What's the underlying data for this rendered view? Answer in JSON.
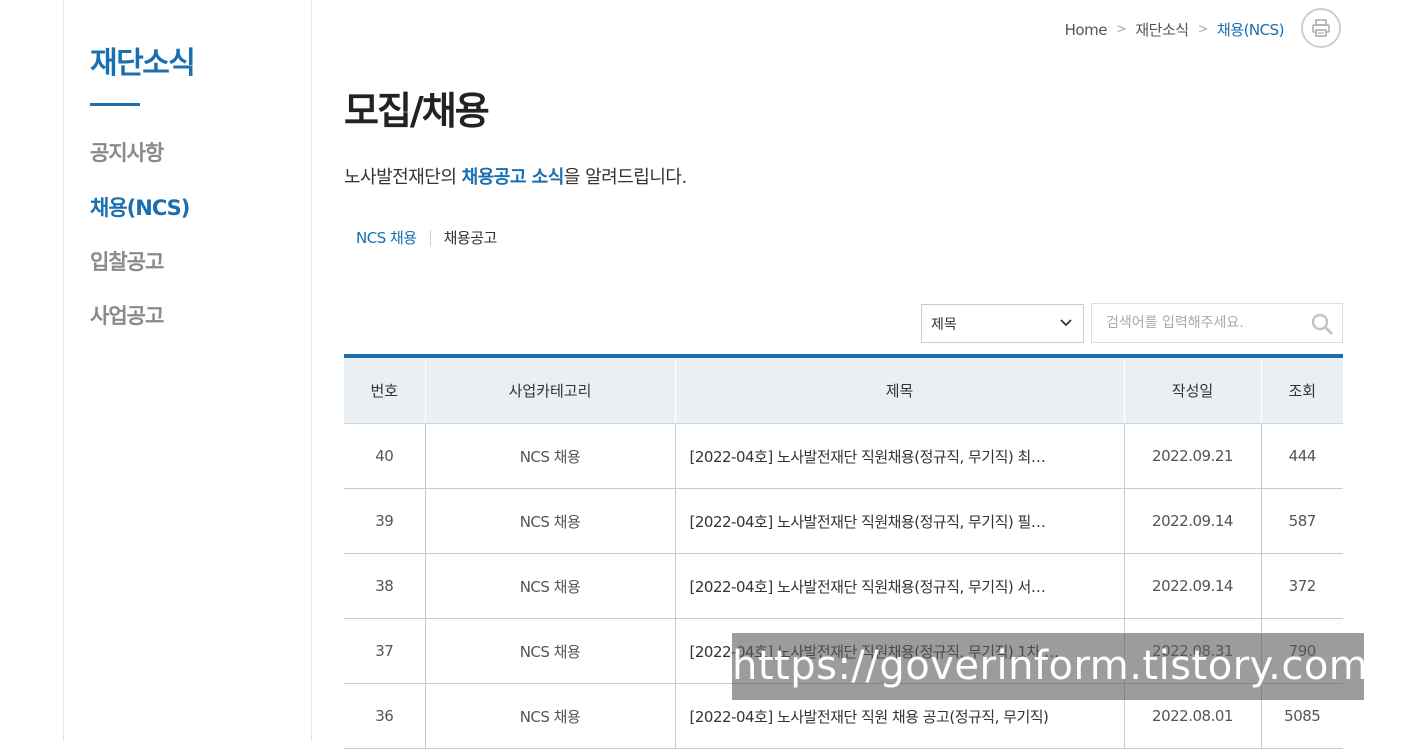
{
  "sidebar": {
    "title": "재단소식",
    "items": [
      {
        "label": "공지사항",
        "active": false
      },
      {
        "label": "채용(NCS)",
        "active": true
      },
      {
        "label": "입찰공고",
        "active": false
      },
      {
        "label": "사업공고",
        "active": false
      }
    ]
  },
  "breadcrumb": {
    "home": "Home",
    "level1": "재단소식",
    "current": "채용(NCS)"
  },
  "print_icon": "printer-icon",
  "page": {
    "title": "모집/채용",
    "intro_before": "노사발전재단의 ",
    "intro_highlight": "채용공고 소식",
    "intro_after": "을 알려드립니다."
  },
  "tabs": [
    {
      "label": "NCS 채용",
      "active": true
    },
    {
      "label": "채용공고",
      "active": false
    }
  ],
  "search": {
    "select_value": "제목",
    "placeholder": "검색어를 입력해주세요.",
    "icon": "search-icon"
  },
  "table": {
    "headers": [
      "번호",
      "사업카테고리",
      "제목",
      "작성일",
      "조회"
    ],
    "rows": [
      {
        "no": "40",
        "category": "NCS 채용",
        "title": "[2022-04호] 노사발전재단 직원채용(정규직, 무기직) 최…",
        "date": "2022.09.21",
        "views": "444"
      },
      {
        "no": "39",
        "category": "NCS 채용",
        "title": "[2022-04호] 노사발전재단 직원채용(정규직, 무기직) 필…",
        "date": "2022.09.14",
        "views": "587"
      },
      {
        "no": "38",
        "category": "NCS 채용",
        "title": "[2022-04호] 노사발전재단 직원채용(정규직, 무기직) 서…",
        "date": "2022.09.14",
        "views": "372"
      },
      {
        "no": "37",
        "category": "NCS 채용",
        "title": "[2022-04호] 노사발전재단 직원채용(정규직, 무기직) 1차 …",
        "date": "2022.08.31",
        "views": "790"
      },
      {
        "no": "36",
        "category": "NCS 채용",
        "title": "[2022-04호] 노사발전재단 직원 채용 공고(정규직, 무기직)",
        "date": "2022.08.01",
        "views": "5085"
      }
    ]
  },
  "watermark": "https://goverinform.tistory.com",
  "colors": {
    "accent": "#1a6fb0",
    "header_bg": "#eaeff3"
  }
}
